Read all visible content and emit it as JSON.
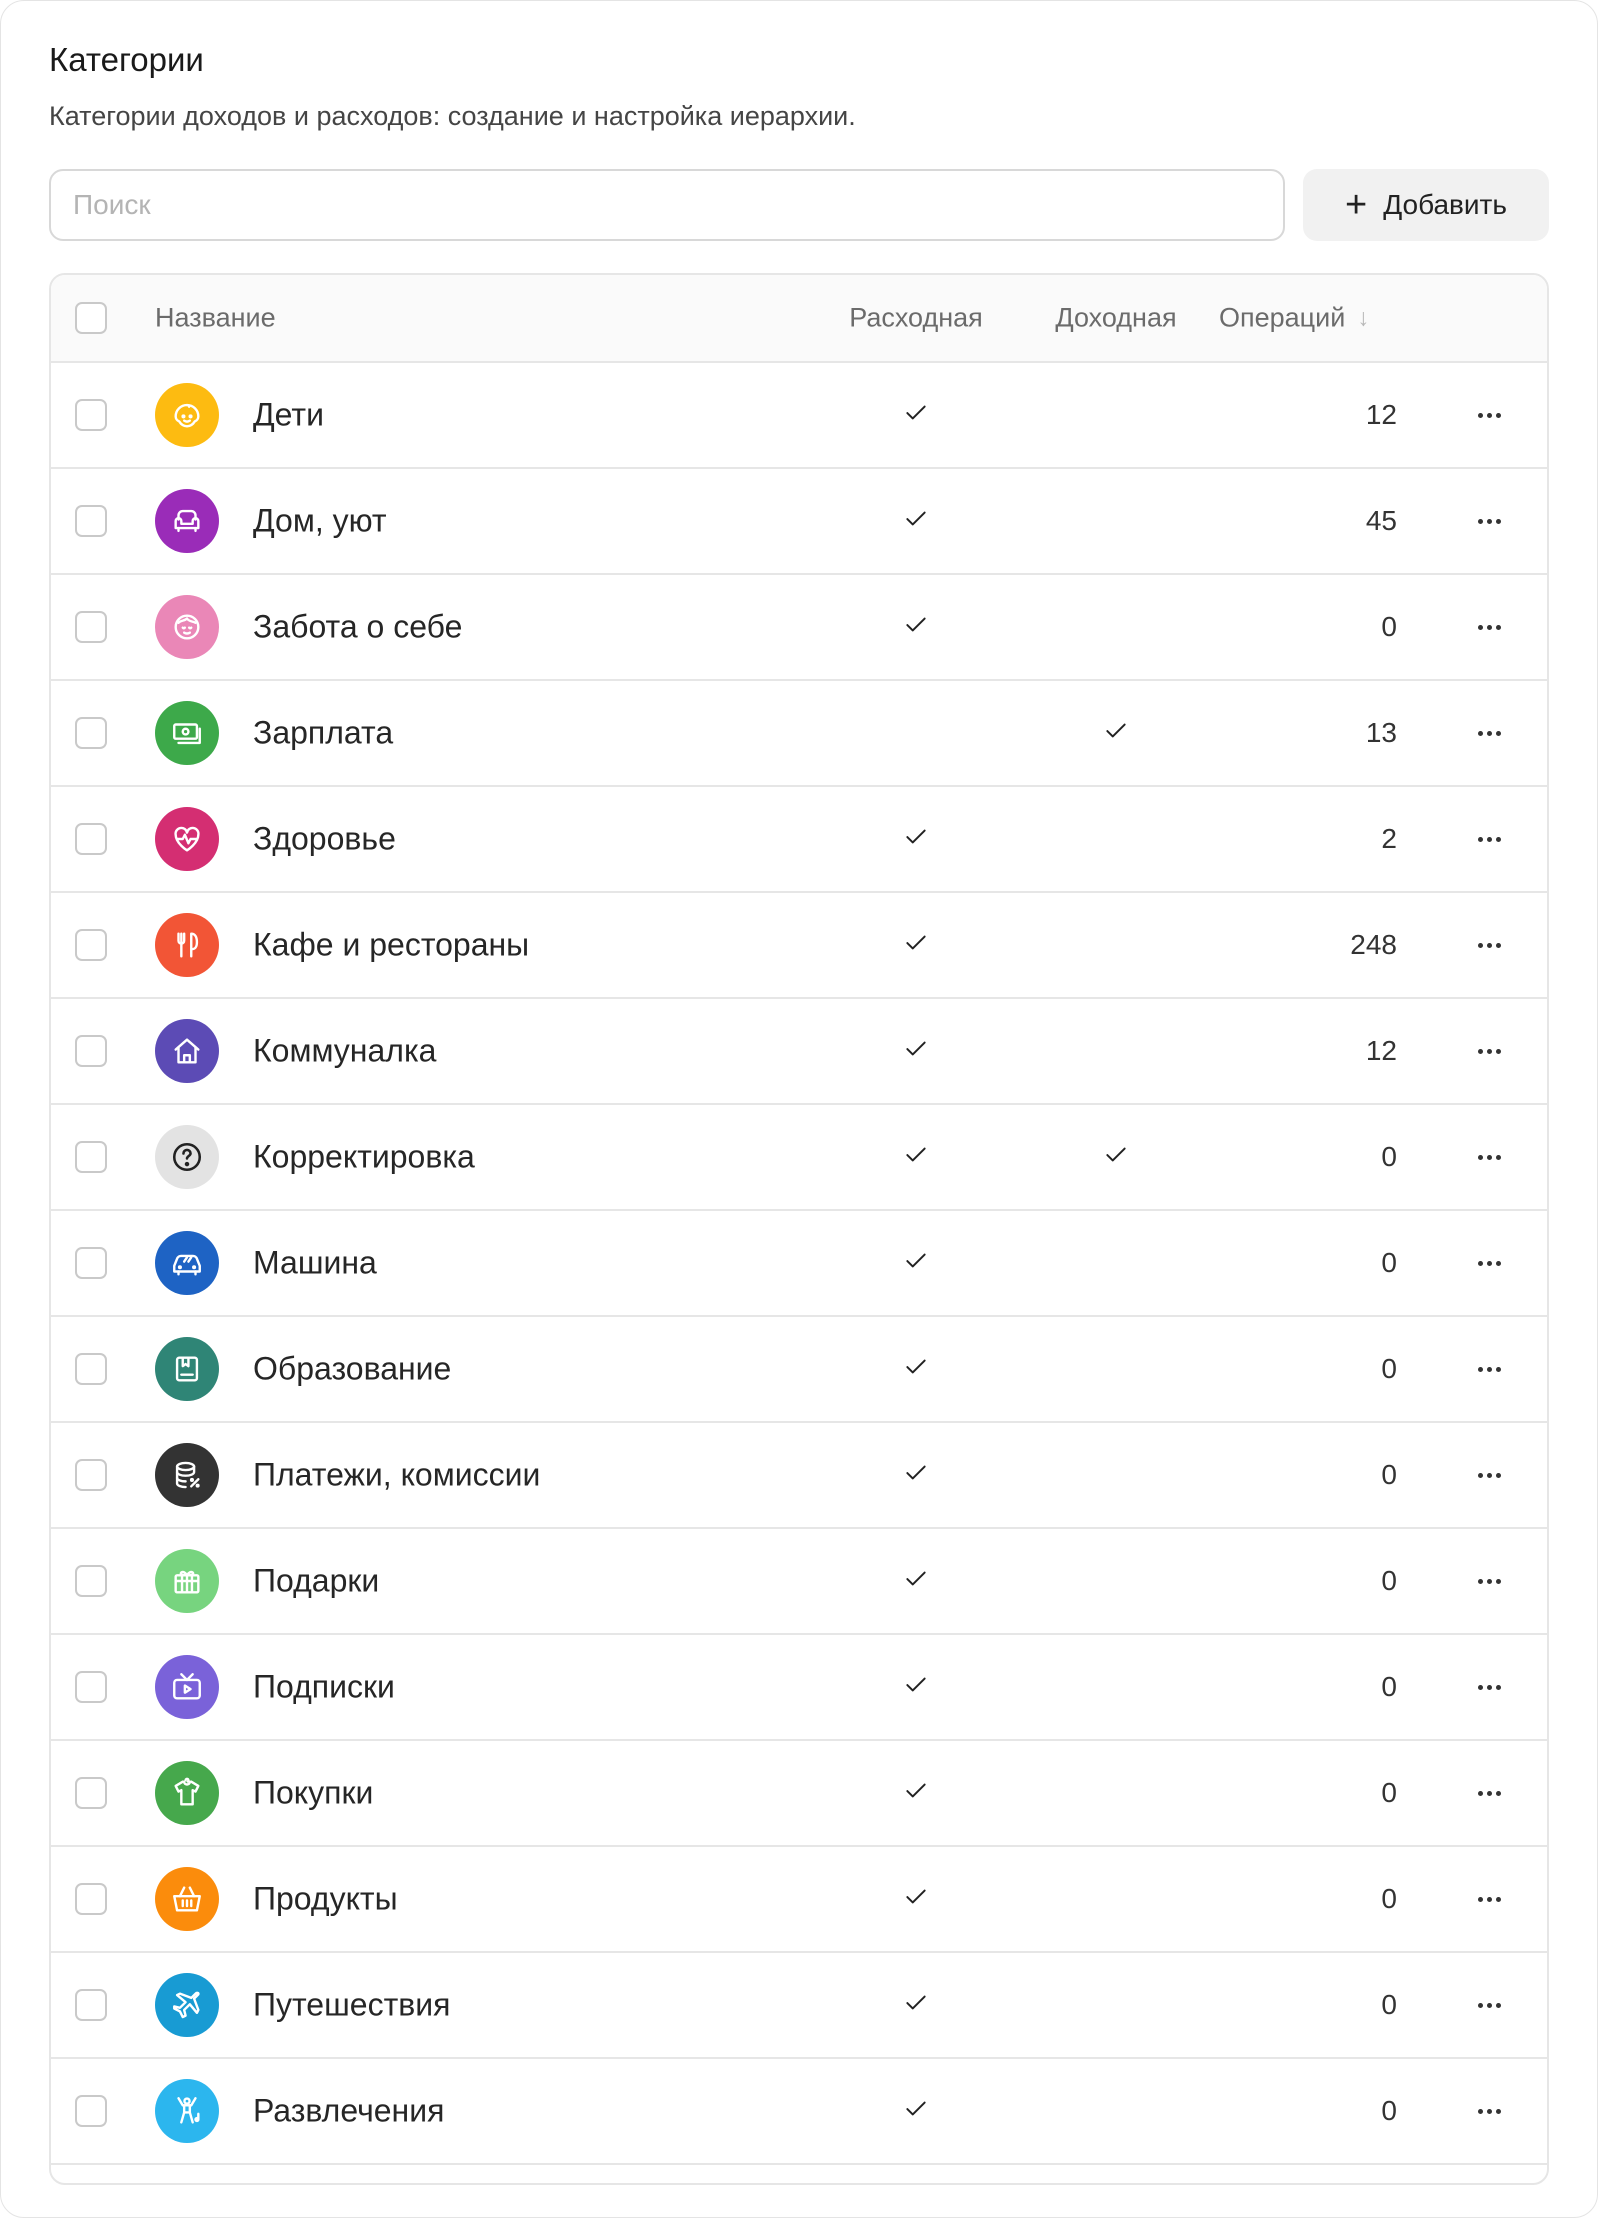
{
  "header": {
    "title": "Категории",
    "subtitle": "Категории доходов и расходов: создание и настройка иерархии."
  },
  "search": {
    "placeholder": "Поиск",
    "value": ""
  },
  "toolbar": {
    "add_label": "Добавить"
  },
  "table": {
    "columns": {
      "name": "Название",
      "expense": "Расходная",
      "income": "Доходная",
      "operations": "Операций"
    },
    "sort": {
      "column": "operations",
      "direction": "desc"
    },
    "rows": [
      {
        "name": "Дети",
        "icon": "child-face-icon",
        "color": "#FDBB11",
        "expense": true,
        "income": false,
        "operations": "12"
      },
      {
        "name": "Дом, уют",
        "icon": "armchair-icon",
        "color": "#9A2CB8",
        "expense": true,
        "income": false,
        "operations": "45"
      },
      {
        "name": "Забота о себе",
        "icon": "self-care-face-icon",
        "color": "#EA87B7",
        "expense": true,
        "income": false,
        "operations": "0"
      },
      {
        "name": "Зарплата",
        "icon": "cash-icon",
        "color": "#3DA94A",
        "expense": false,
        "income": true,
        "operations": "13"
      },
      {
        "name": "Здоровье",
        "icon": "heart-pulse-icon",
        "color": "#D42E72",
        "expense": true,
        "income": false,
        "operations": "2"
      },
      {
        "name": "Кафе и рестораны",
        "icon": "cutlery-icon",
        "color": "#F25536",
        "expense": true,
        "income": false,
        "operations": "248"
      },
      {
        "name": "Коммуналка",
        "icon": "house-icon",
        "color": "#5C4BB5",
        "expense": true,
        "income": false,
        "operations": "12"
      },
      {
        "name": "Корректировка",
        "icon": "question-icon",
        "color": "#E3E3E3",
        "expense": true,
        "income": true,
        "operations": "0"
      },
      {
        "name": "Машина",
        "icon": "car-icon",
        "color": "#1E63C4",
        "expense": true,
        "income": false,
        "operations": "0"
      },
      {
        "name": "Образование",
        "icon": "book-icon",
        "color": "#2F8576",
        "expense": true,
        "income": false,
        "operations": "0"
      },
      {
        "name": "Платежи, комиссии",
        "icon": "coins-percent-icon",
        "color": "#333333",
        "expense": true,
        "income": false,
        "operations": "0"
      },
      {
        "name": "Подарки",
        "icon": "gift-icon",
        "color": "#77D47F",
        "expense": true,
        "income": false,
        "operations": "0"
      },
      {
        "name": "Подписки",
        "icon": "tv-play-icon",
        "color": "#7A62D9",
        "expense": true,
        "income": false,
        "operations": "0"
      },
      {
        "name": "Покупки",
        "icon": "tshirt-icon",
        "color": "#46A84C",
        "expense": true,
        "income": false,
        "operations": "0"
      },
      {
        "name": "Продукты",
        "icon": "basket-icon",
        "color": "#FB8C0C",
        "expense": true,
        "income": false,
        "operations": "0"
      },
      {
        "name": "Путешествия",
        "icon": "airplane-icon",
        "color": "#189BD3",
        "expense": true,
        "income": false,
        "operations": "0"
      },
      {
        "name": "Развлечения",
        "icon": "dancer-icon",
        "color": "#2CB6EE",
        "expense": true,
        "income": false,
        "operations": "0"
      }
    ]
  }
}
